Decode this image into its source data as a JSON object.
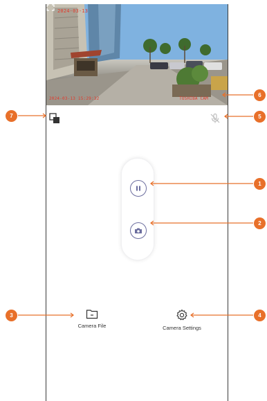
{
  "video": {
    "osd_top": "2024-03-13",
    "osd_bottom_left": "2024-03-13 15:29:32",
    "osd_bottom_right": "TOSHIBA CAM"
  },
  "actions": {
    "camera_file": "Camera File",
    "camera_settings": "Camera Settings"
  },
  "callouts": [
    "1",
    "2",
    "3",
    "4",
    "5",
    "6",
    "7"
  ],
  "colors": {
    "accent": "#6b6d9e",
    "callout": "#e8702a",
    "osd": "#e23a2c"
  }
}
